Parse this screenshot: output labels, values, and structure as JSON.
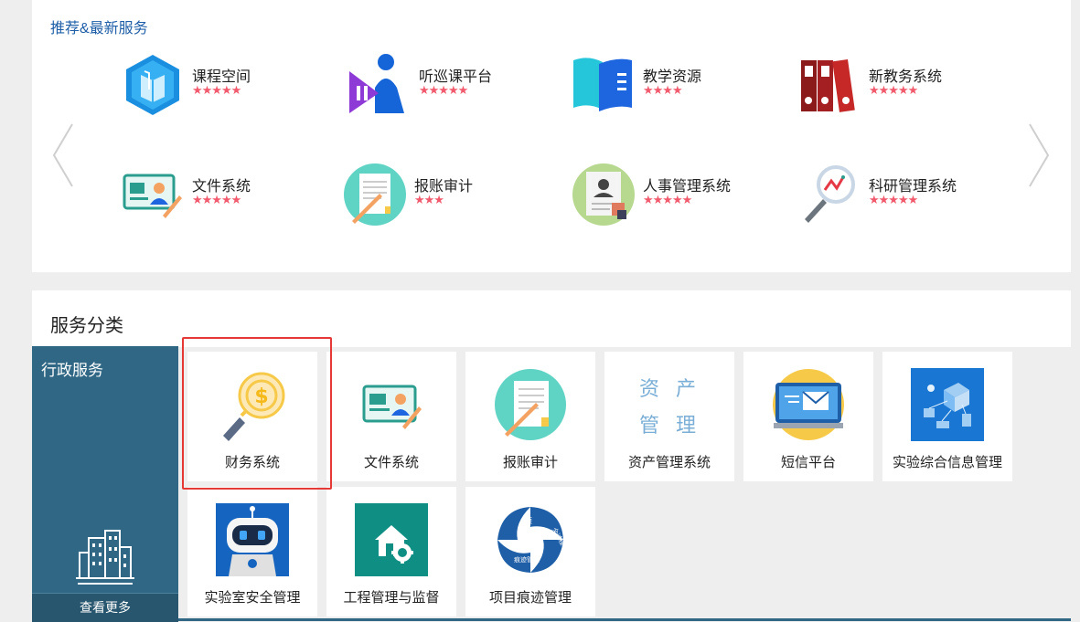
{
  "recommended": {
    "title": "推荐&最新服务",
    "items": [
      {
        "name": "课程空间",
        "stars": "★★★★★"
      },
      {
        "name": "听巡课平台",
        "stars": "★★★★★"
      },
      {
        "name": "教学资源",
        "stars": "★★★★"
      },
      {
        "name": "新教务系统",
        "stars": "★★★★★"
      },
      {
        "name": "文件系统",
        "stars": "★★★★★"
      },
      {
        "name": "报账审计",
        "stars": "★★★"
      },
      {
        "name": "人事管理系统",
        "stars": "★★★★★"
      },
      {
        "name": "科研管理系统",
        "stars": "★★★★★"
      }
    ]
  },
  "categories": {
    "title": "服务分类",
    "sidebar": {
      "title": "行政服务",
      "more_label": "查看更多"
    },
    "services": [
      {
        "label": "财务系统"
      },
      {
        "label": "文件系统"
      },
      {
        "label": "报账审计"
      },
      {
        "label": "资产管理系统",
        "icon_text": [
          "资",
          "产",
          "管",
          "理"
        ]
      },
      {
        "label": "短信平台"
      },
      {
        "label": "实验综合信息管理"
      },
      {
        "label": "实验室安全管理"
      },
      {
        "label": "工程管理与监督"
      },
      {
        "label": "项目痕迹管理",
        "icon_text": [
          "项",
          "目",
          "痕迹管理",
          "全过程"
        ]
      }
    ]
  },
  "colors": {
    "accent": "#1f5fa8",
    "star": "#f25a6e",
    "sidebar": "#2f6784",
    "highlight": "#e53935"
  }
}
